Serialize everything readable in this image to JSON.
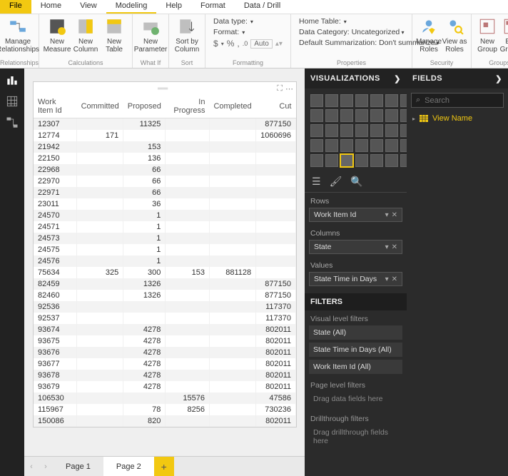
{
  "tabs": {
    "file": "File",
    "home": "Home",
    "view": "View",
    "modeling": "Modeling",
    "help": "Help",
    "format": "Format",
    "datadrill": "Data / Drill"
  },
  "ribbon": {
    "relationships": {
      "manage": "Manage\nRelationships",
      "group": "Relationships"
    },
    "calc": {
      "measure": "New\nMeasure",
      "column": "New\nColumn",
      "table": "New\nTable",
      "group": "Calculations"
    },
    "whatif": {
      "param": "New\nParameter",
      "group": "What If"
    },
    "sort": {
      "btn": "Sort by\nColumn",
      "group": "Sort"
    },
    "formatting": {
      "datatype": "Data type:",
      "format": "Format:",
      "auto": "Auto",
      "group": "Formatting",
      "sym_dollar": "$",
      "sym_pct": "%",
      "sym_comma": ","
    },
    "properties": {
      "home": "Home Table:",
      "cat": "Data Category: Uncategorized",
      "summ": "Default Summarization: Don't summarize",
      "group": "Properties"
    },
    "security": {
      "manage": "Manage\nRoles",
      "viewas": "View as\nRoles",
      "group": "Security"
    },
    "groups": {
      "new": "New\nGroup",
      "edit": "Edit\nGroups",
      "group": "Groups"
    }
  },
  "pages": {
    "p1": "Page 1",
    "p2": "Page 2"
  },
  "viz": {
    "title": "VISUALIZATIONS",
    "wells": {
      "rows": "Rows",
      "columns": "Columns",
      "values": "Values",
      "rows_val": "Work Item Id",
      "cols_val": "State",
      "vals_val": "State Time in Days"
    },
    "filters_title": "FILTERS",
    "vlf": "Visual level filters",
    "f_state": "State  (All)",
    "f_time": "State Time in Days  (All)",
    "f_wid": "Work Item Id  (All)",
    "plf": "Page level filters",
    "plf_empty": "Drag data fields here",
    "dtf": "Drillthrough filters",
    "dtf_empty": "Drag drillthrough fields here"
  },
  "fields": {
    "title": "FIELDS",
    "search_ph": "Search",
    "view": "View Name"
  },
  "chart_data": {
    "type": "table",
    "columns": [
      "Work Item Id",
      "Committed",
      "Proposed",
      "In Progress",
      "Completed",
      "Cut"
    ],
    "rows": [
      [
        "12307",
        "",
        "11325",
        "",
        "",
        "877150"
      ],
      [
        "12774",
        "171",
        "",
        "",
        "",
        "1060696"
      ],
      [
        "21942",
        "",
        "153",
        "",
        "",
        ""
      ],
      [
        "22150",
        "",
        "136",
        "",
        "",
        ""
      ],
      [
        "22968",
        "",
        "66",
        "",
        "",
        ""
      ],
      [
        "22970",
        "",
        "66",
        "",
        "",
        ""
      ],
      [
        "22971",
        "",
        "66",
        "",
        "",
        ""
      ],
      [
        "23011",
        "",
        "36",
        "",
        "",
        ""
      ],
      [
        "24570",
        "",
        "1",
        "",
        "",
        ""
      ],
      [
        "24571",
        "",
        "1",
        "",
        "",
        ""
      ],
      [
        "24573",
        "",
        "1",
        "",
        "",
        ""
      ],
      [
        "24575",
        "",
        "1",
        "",
        "",
        ""
      ],
      [
        "24576",
        "",
        "1",
        "",
        "",
        ""
      ],
      [
        "75634",
        "325",
        "300",
        "153",
        "881128",
        ""
      ],
      [
        "82459",
        "",
        "1326",
        "",
        "",
        "877150"
      ],
      [
        "82460",
        "",
        "1326",
        "",
        "",
        "877150"
      ],
      [
        "92536",
        "",
        "",
        "",
        "",
        "117370"
      ],
      [
        "92537",
        "",
        "",
        "",
        "",
        "117370"
      ],
      [
        "93674",
        "",
        "4278",
        "",
        "",
        "802011"
      ],
      [
        "93675",
        "",
        "4278",
        "",
        "",
        "802011"
      ],
      [
        "93676",
        "",
        "4278",
        "",
        "",
        "802011"
      ],
      [
        "93677",
        "",
        "4278",
        "",
        "",
        "802011"
      ],
      [
        "93678",
        "",
        "4278",
        "",
        "",
        "802011"
      ],
      [
        "93679",
        "",
        "4278",
        "",
        "",
        "802011"
      ],
      [
        "106530",
        "",
        "",
        "15576",
        "",
        "47586"
      ],
      [
        "115967",
        "",
        "78",
        "8256",
        "",
        "730236"
      ],
      [
        "150086",
        "",
        "820",
        "",
        "",
        "802011"
      ]
    ]
  }
}
